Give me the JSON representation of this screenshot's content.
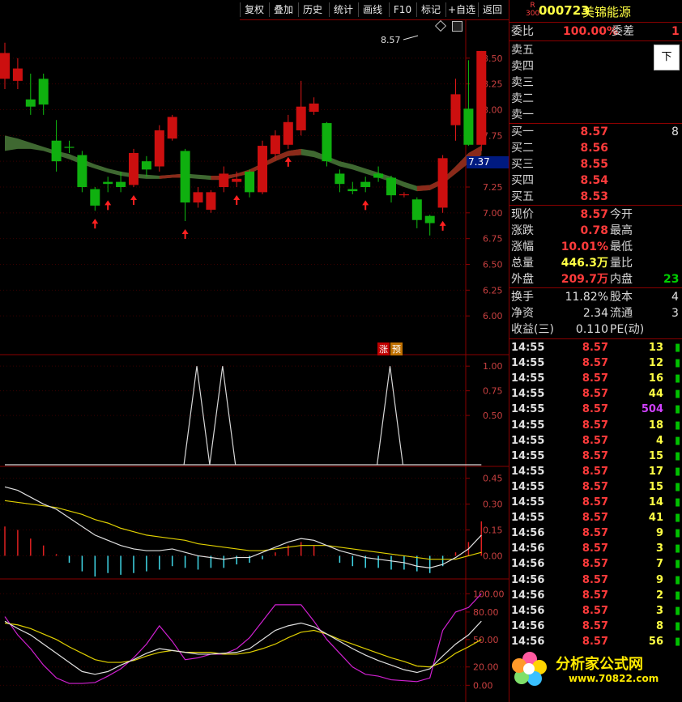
{
  "toolbar": {
    "buttons": [
      "复权",
      "叠加",
      "历史",
      "统计",
      "画线",
      "F10",
      "标记",
      "+自选",
      "返回"
    ]
  },
  "header": {
    "badge_top": "R",
    "badge_bottom": "300",
    "code": "000723",
    "name": "美锦能源"
  },
  "quote": {
    "weibi_label": "委比",
    "weibi_value": "100.00%",
    "weicha_label": "委差",
    "weicha_value": "1",
    "sell_labels": [
      "卖五",
      "卖四",
      "卖三",
      "卖二",
      "卖一"
    ],
    "buy": [
      {
        "label": "买一",
        "price": "8.57",
        "vol": "8"
      },
      {
        "label": "买二",
        "price": "8.56",
        "vol": ""
      },
      {
        "label": "买三",
        "price": "8.55",
        "vol": ""
      },
      {
        "label": "买四",
        "price": "8.54",
        "vol": ""
      },
      {
        "label": "买五",
        "price": "8.53",
        "vol": ""
      }
    ],
    "stats": [
      {
        "l1": "现价",
        "v1": "8.57",
        "c1": "red",
        "l2": "今开",
        "v2": ""
      },
      {
        "l1": "涨跌",
        "v1": "0.78",
        "c1": "red",
        "l2": "最高",
        "v2": ""
      },
      {
        "l1": "涨幅",
        "v1": "10.01%",
        "c1": "red",
        "l2": "最低",
        "v2": ""
      },
      {
        "l1": "总量",
        "v1": "446.3万",
        "c1": "yel",
        "l2": "量比",
        "v2": ""
      },
      {
        "l1": "外盘",
        "v1": "209.7万",
        "c1": "red",
        "l2": "内盘",
        "v2": "23"
      }
    ],
    "stats2": [
      {
        "l1": "换手",
        "v1": "11.82%",
        "l2": "股本",
        "v2": "4"
      },
      {
        "l1": "净资",
        "v1": "2.34",
        "l2": "流通",
        "v2": "3"
      },
      {
        "l1": "收益(三)",
        "v1": "0.110",
        "l2": "PE(动)",
        "v2": ""
      }
    ],
    "popup_label": "下"
  },
  "ticks": [
    {
      "time": "14:55",
      "price": "8.57",
      "vol": "13",
      "vc": "yel"
    },
    {
      "time": "14:55",
      "price": "8.57",
      "vol": "12",
      "vc": "yel"
    },
    {
      "time": "14:55",
      "price": "8.57",
      "vol": "16",
      "vc": "yel"
    },
    {
      "time": "14:55",
      "price": "8.57",
      "vol": "44",
      "vc": "yel"
    },
    {
      "time": "14:55",
      "price": "8.57",
      "vol": "504",
      "vc": "mag"
    },
    {
      "time": "14:55",
      "price": "8.57",
      "vol": "18",
      "vc": "yel"
    },
    {
      "time": "14:55",
      "price": "8.57",
      "vol": "4",
      "vc": "yel"
    },
    {
      "time": "14:55",
      "price": "8.57",
      "vol": "15",
      "vc": "yel"
    },
    {
      "time": "14:55",
      "price": "8.57",
      "vol": "17",
      "vc": "yel"
    },
    {
      "time": "14:55",
      "price": "8.57",
      "vol": "15",
      "vc": "yel"
    },
    {
      "time": "14:55",
      "price": "8.57",
      "vol": "14",
      "vc": "yel"
    },
    {
      "time": "14:55",
      "price": "8.57",
      "vol": "41",
      "vc": "yel"
    },
    {
      "time": "14:56",
      "price": "8.57",
      "vol": "9",
      "vc": "yel"
    },
    {
      "time": "14:56",
      "price": "8.57",
      "vol": "3",
      "vc": "yel"
    },
    {
      "time": "14:56",
      "price": "8.57",
      "vol": "7",
      "vc": "yel"
    },
    {
      "time": "14:56",
      "price": "8.57",
      "vol": "9",
      "vc": "yel"
    },
    {
      "time": "14:56",
      "price": "8.57",
      "vol": "2",
      "vc": "yel"
    },
    {
      "time": "14:56",
      "price": "8.57",
      "vol": "3",
      "vc": "yel"
    },
    {
      "time": "14:56",
      "price": "8.57",
      "vol": "8",
      "vc": "yel"
    },
    {
      "time": "14:56",
      "price": "8.57",
      "vol": "56",
      "vc": "yel"
    }
  ],
  "watermark": {
    "title": "分析家公式网",
    "url": "www.70822.com"
  },
  "chart_data": [
    {
      "type": "candlestick",
      "ylim": [
        5.75,
        8.75
      ],
      "yticks": [
        "8.50",
        "8.25",
        "8.00",
        "7.75",
        "7.50",
        "7.25",
        "7.00",
        "6.75",
        "6.50",
        "6.25",
        "6.00"
      ],
      "current_price_label": "7.37",
      "high_label": "8.57",
      "markers": [
        "涨",
        "预"
      ],
      "candles": [
        {
          "o": 8.3,
          "c": 8.55,
          "h": 8.65,
          "l": 8.2
        },
        {
          "o": 8.28,
          "c": 8.4,
          "h": 8.5,
          "l": 8.2
        },
        {
          "o": 8.1,
          "c": 8.03,
          "h": 8.35,
          "l": 7.95
        },
        {
          "o": 8.3,
          "c": 8.05,
          "h": 8.35,
          "l": 7.95
        },
        {
          "o": 7.7,
          "c": 7.5,
          "h": 7.9,
          "l": 7.4
        },
        {
          "o": 7.64,
          "c": 7.63,
          "h": 7.7,
          "l": 7.58
        },
        {
          "o": 7.56,
          "c": 7.25,
          "h": 7.6,
          "l": 7.2
        },
        {
          "o": 7.23,
          "c": 7.07,
          "h": 7.25,
          "l": 7.02
        },
        {
          "o": 7.3,
          "c": 7.28,
          "h": 7.35,
          "l": 7.2
        },
        {
          "o": 7.3,
          "c": 7.25,
          "h": 7.4,
          "l": 7.2
        },
        {
          "o": 7.27,
          "c": 7.58,
          "h": 7.62,
          "l": 7.25
        },
        {
          "o": 7.5,
          "c": 7.42,
          "h": 7.55,
          "l": 7.35
        },
        {
          "o": 7.45,
          "c": 7.8,
          "h": 7.85,
          "l": 7.4
        },
        {
          "o": 7.72,
          "c": 7.93,
          "h": 7.95,
          "l": 7.7
        },
        {
          "o": 7.6,
          "c": 7.1,
          "h": 7.62,
          "l": 6.92
        },
        {
          "o": 7.1,
          "c": 7.2,
          "h": 7.25,
          "l": 7.05
        },
        {
          "o": 7.03,
          "c": 7.2,
          "h": 7.22,
          "l": 7.0
        },
        {
          "o": 7.25,
          "c": 7.38,
          "h": 7.45,
          "l": 7.2
        },
        {
          "o": 7.3,
          "c": 7.33,
          "h": 7.4,
          "l": 7.25
        },
        {
          "o": 7.4,
          "c": 7.2,
          "h": 7.42,
          "l": 7.15
        },
        {
          "o": 7.2,
          "c": 7.65,
          "h": 7.7,
          "l": 7.18
        },
        {
          "o": 7.57,
          "c": 7.75,
          "h": 7.8,
          "l": 7.52
        },
        {
          "o": 7.66,
          "c": 7.88,
          "h": 7.95,
          "l": 7.62
        },
        {
          "o": 7.8,
          "c": 8.03,
          "h": 8.28,
          "l": 7.75
        },
        {
          "o": 7.98,
          "c": 8.06,
          "h": 8.12,
          "l": 7.95
        },
        {
          "o": 7.87,
          "c": 7.5,
          "h": 7.88,
          "l": 7.45
        },
        {
          "o": 7.38,
          "c": 7.28,
          "h": 7.42,
          "l": 7.2
        },
        {
          "o": 7.23,
          "c": 7.21,
          "h": 7.3,
          "l": 7.18
        },
        {
          "o": 7.3,
          "c": 7.25,
          "h": 7.35,
          "l": 7.2
        },
        {
          "o": 7.38,
          "c": 7.34,
          "h": 7.45,
          "l": 7.3
        },
        {
          "o": 7.34,
          "c": 7.17,
          "h": 7.36,
          "l": 7.1
        },
        {
          "o": 7.17,
          "c": 7.18,
          "h": 7.2,
          "l": 7.15
        },
        {
          "o": 7.13,
          "c": 6.93,
          "h": 7.15,
          "l": 6.85
        },
        {
          "o": 6.97,
          "c": 6.9,
          "h": 6.98,
          "l": 6.78
        },
        {
          "o": 7.05,
          "c": 7.53,
          "h": 7.56,
          "l": 7.0
        },
        {
          "o": 7.85,
          "c": 8.15,
          "h": 8.3,
          "l": 7.7
        },
        {
          "o": 8.01,
          "c": 7.66,
          "h": 8.48,
          "l": 7.65
        },
        {
          "o": 7.66,
          "c": 8.57,
          "h": 8.57,
          "l": 7.6
        }
      ],
      "band_upper": [
        7.75,
        7.72,
        7.68,
        7.64,
        7.6,
        7.57,
        7.52,
        7.47,
        7.43,
        7.4,
        7.38,
        7.37,
        7.36,
        7.37,
        7.38,
        7.37,
        7.36,
        7.36,
        7.38,
        7.42,
        7.48,
        7.55,
        7.6,
        7.62,
        7.6,
        7.55,
        7.5,
        7.47,
        7.43,
        7.39,
        7.35,
        7.3,
        7.26,
        7.27,
        7.33,
        7.45,
        7.58,
        7.65
      ],
      "band_lower": [
        7.6,
        7.62,
        7.62,
        7.6,
        7.56,
        7.52,
        7.47,
        7.43,
        7.39,
        7.36,
        7.34,
        7.33,
        7.33,
        7.34,
        7.34,
        7.33,
        7.32,
        7.32,
        7.35,
        7.38,
        7.44,
        7.5,
        7.55,
        7.56,
        7.54,
        7.5,
        7.45,
        7.42,
        7.38,
        7.34,
        7.3,
        7.25,
        7.21,
        7.22,
        7.28,
        7.38,
        7.48,
        7.56
      ],
      "up_arrows": [
        7,
        8,
        10,
        14,
        18,
        22,
        28,
        34
      ],
      "down_arrows": [
        0,
        8,
        12,
        18,
        24,
        30
      ]
    },
    {
      "type": "line",
      "ylim": [
        0,
        1.1
      ],
      "yticks": [
        "1.00",
        "0.75",
        "0.50"
      ],
      "values": [
        0,
        0,
        0,
        0,
        0,
        0,
        0,
        0,
        0,
        0,
        0,
        0,
        0,
        0,
        0,
        0,
        0,
        0,
        0,
        0,
        0,
        0,
        0,
        0,
        0,
        0,
        0,
        0,
        0,
        0,
        0,
        0,
        0,
        0,
        0,
        0,
        0,
        0
      ]
    },
    {
      "type": "macd",
      "ylim": [
        -0.12,
        0.5
      ],
      "yticks": [
        "0.45",
        "0.30",
        "0.15",
        "0.00"
      ],
      "dif": [
        0.4,
        0.38,
        0.34,
        0.3,
        0.27,
        0.22,
        0.17,
        0.12,
        0.09,
        0.06,
        0.04,
        0.03,
        0.03,
        0.04,
        0.02,
        0.0,
        -0.01,
        -0.02,
        -0.01,
        -0.01,
        0.02,
        0.05,
        0.08,
        0.1,
        0.09,
        0.06,
        0.03,
        0.01,
        -0.01,
        -0.02,
        -0.03,
        -0.04,
        -0.06,
        -0.07,
        -0.05,
        -0.01,
        0.04,
        0.12
      ],
      "dea": [
        0.32,
        0.31,
        0.3,
        0.29,
        0.28,
        0.26,
        0.24,
        0.21,
        0.19,
        0.16,
        0.14,
        0.12,
        0.11,
        0.1,
        0.09,
        0.07,
        0.06,
        0.05,
        0.04,
        0.03,
        0.03,
        0.04,
        0.05,
        0.06,
        0.06,
        0.06,
        0.05,
        0.04,
        0.03,
        0.02,
        0.01,
        0.0,
        -0.01,
        -0.02,
        -0.02,
        -0.02,
        0.0,
        0.02
      ],
      "hist": [
        0.17,
        0.15,
        0.1,
        0.06,
        0.01,
        -0.04,
        -0.09,
        -0.12,
        -0.1,
        -0.11,
        -0.1,
        -0.09,
        -0.08,
        -0.06,
        -0.07,
        -0.08,
        -0.07,
        -0.07,
        -0.05,
        -0.04,
        -0.02,
        0.02,
        0.06,
        0.08,
        0.06,
        0.0,
        -0.04,
        -0.06,
        -0.07,
        -0.07,
        -0.08,
        -0.08,
        -0.09,
        -0.1,
        -0.06,
        0.02,
        0.08,
        0.2
      ]
    },
    {
      "type": "kdj",
      "ylim": [
        -5,
        110
      ],
      "yticks": [
        "100.00",
        "80.00",
        "50.00",
        "20.00",
        "0.00"
      ],
      "k": [
        70,
        62,
        55,
        45,
        35,
        25,
        15,
        12,
        15,
        22,
        28,
        35,
        40,
        38,
        36,
        34,
        34,
        35,
        36,
        40,
        50,
        60,
        65,
        68,
        64,
        56,
        48,
        40,
        33,
        27,
        22,
        17,
        14,
        18,
        32,
        45,
        55,
        70
      ],
      "d": [
        68,
        66,
        62,
        56,
        50,
        42,
        35,
        28,
        25,
        25,
        27,
        32,
        36,
        38,
        36,
        36,
        36,
        34,
        34,
        36,
        40,
        45,
        52,
        58,
        60,
        56,
        50,
        45,
        40,
        35,
        30,
        26,
        21,
        20,
        25,
        35,
        42,
        50
      ],
      "j": [
        75,
        55,
        40,
        22,
        8,
        2,
        2,
        3,
        10,
        18,
        30,
        45,
        65,
        48,
        28,
        30,
        34,
        34,
        40,
        52,
        70,
        88,
        88,
        88,
        70,
        50,
        35,
        20,
        12,
        10,
        6,
        5,
        4,
        8,
        60,
        80,
        85,
        100
      ]
    }
  ]
}
